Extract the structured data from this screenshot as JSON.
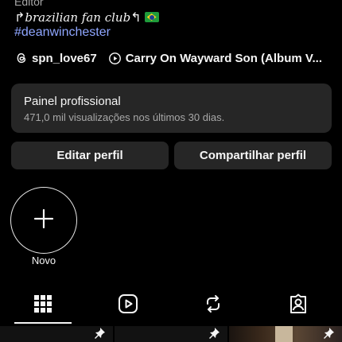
{
  "profile": {
    "category": "Editor",
    "bio_prefix_arrow": "↱",
    "bio_script": "brazilian fan club",
    "bio_suffix_arrow": "↰",
    "flag_icon": "brazil-flag-icon",
    "hashtag": "#deanwinchester",
    "threads_handle": "spn_love67",
    "music_track": "Carry On Wayward Son (Album V..."
  },
  "professional_dashboard": {
    "title": "Painel profissional",
    "subtitle": "471,0 mil visualizações nos últimos 30 dias."
  },
  "buttons": {
    "edit_profile": "Editar perfil",
    "share_profile": "Compartilhar perfil"
  },
  "highlights": {
    "new_label": "Novo"
  },
  "tabs": [
    {
      "name": "grid",
      "icon": "grid-icon",
      "active": true
    },
    {
      "name": "reels",
      "icon": "reels-play-icon",
      "active": false
    },
    {
      "name": "reposts",
      "icon": "repost-icon",
      "active": false
    },
    {
      "name": "tagged",
      "icon": "tagged-person-icon",
      "active": false
    }
  ],
  "colors": {
    "background": "#000000",
    "card": "#262626",
    "hashtag_link": "#8fa6ff",
    "secondary_text": "#a8a8a8"
  }
}
